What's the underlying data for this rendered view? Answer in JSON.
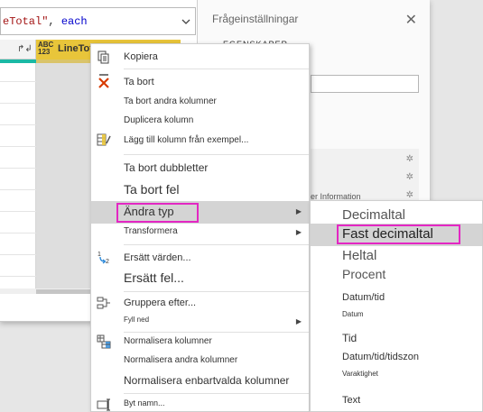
{
  "formula_bar": {
    "part_string": "eTotal\"",
    "part_sep": ", ",
    "part_keyword": "each"
  },
  "grid": {
    "left_header_icon": "↱↲",
    "column_type_top": "ABC",
    "column_type_bottom": "123",
    "column_name": "LineTot"
  },
  "settings_panel": {
    "title": "Frågeinställningar",
    "close_glyph": "✕",
    "properties_heading": "EGENSKAPER",
    "step_info_text": "er Information"
  },
  "context_menu": {
    "copy": "Kopiera",
    "remove": "Ta bort",
    "remove_other_columns": "Ta bort andra kolumner",
    "duplicate_column": "Duplicera kolumn",
    "add_column_from_examples": "Lägg till kolumn från exempel...",
    "remove_duplicates": "Ta bort dubbletter",
    "remove_errors": "Ta bort fel",
    "change_type": "Ändra typ",
    "transform": "Transformera",
    "replace_values": "Ersätt värden...",
    "replace_errors": "Ersätt fel...",
    "group_by": "Gruppera efter...",
    "fill": "Fyll ned",
    "unpivot_columns": "Normalisera kolumner",
    "unpivot_other_columns": "Normalisera andra kolumner",
    "unpivot_only_selected": "Normalisera enbartvalda kolumner",
    "rename": "Byt namn..."
  },
  "submenu": {
    "decimal_number": "Decimaltal",
    "fixed_decimal_number": "Fast decimaltal",
    "whole_number": "Heltal",
    "percentage": "Procent",
    "date_time": "Datum/tid",
    "date": "Datum",
    "time": "Tid",
    "date_time_timezone": "Datum/tid/tidszon",
    "duration": "Varaktighet",
    "text": "Text"
  },
  "colors": {
    "highlight_border": "#e327c3",
    "hover_background": "#d4d4d4",
    "column_header_selected": "#e8c53a",
    "teal_quality_bar": "#1ab9a5",
    "remove_icon_red": "#d83b01"
  }
}
